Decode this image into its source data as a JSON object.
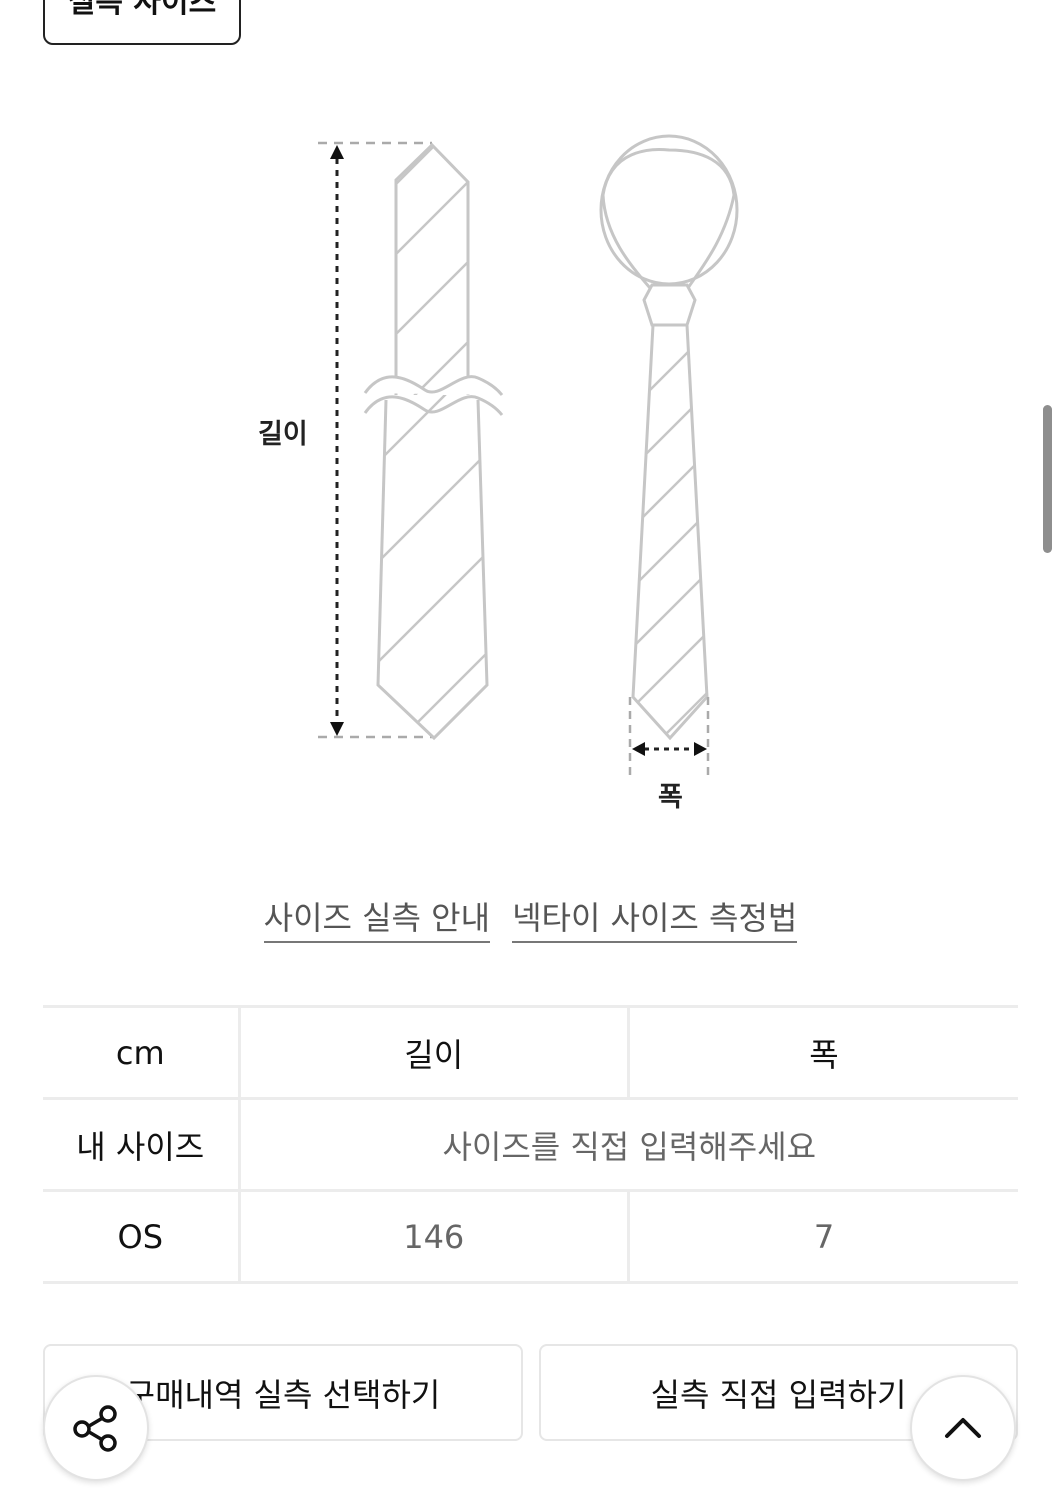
{
  "top_tab": {
    "label": "실측 사이즈"
  },
  "diagram": {
    "length_label": "길이",
    "width_label": "폭"
  },
  "links": {
    "size_guide": "사이즈 실측 안내",
    "measure_method": "넥타이 사이즈 측정법"
  },
  "table": {
    "header": {
      "unit": "cm",
      "col1": "길이",
      "col2": "폭"
    },
    "my_size": {
      "label": "내 사이즈",
      "placeholder": "사이즈를 직접 입력해주세요"
    },
    "rows": [
      {
        "size": "OS",
        "length": "146",
        "width": "7"
      }
    ]
  },
  "buttons": {
    "purchase_history": "구매내역 실측 선택하기",
    "direct_input": "실측 직접 입력하기"
  },
  "floating": {
    "share_icon": "share-icon",
    "top_icon": "chevron-up-icon"
  }
}
